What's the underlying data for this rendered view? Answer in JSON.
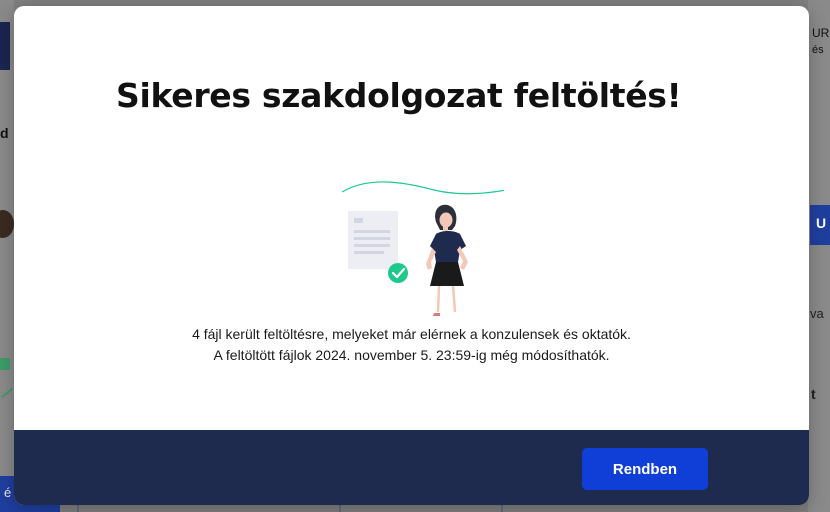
{
  "background": {
    "left_fragment_1": "d",
    "left_button_fragment": "é",
    "right_fragment_1": "UR",
    "right_fragment_2": "és",
    "right_button_fragment": "U",
    "right_fragment_3": "va",
    "right_fragment_4": "t"
  },
  "modal": {
    "title": "Sikeres szakdolgozat feltöltés!",
    "message_line_1": "4 fájl került feltöltésre, melyeket már elérnek a konzulensek és oktatók.",
    "message_line_2": "A feltöltött fájlok 2024. november 5. 23:59-ig még módosíthatók.",
    "ok_button_label": "Rendben"
  },
  "colors": {
    "footer": "#1f2a4f",
    "button": "#0f3fd6",
    "accent_green": "#1ec98b"
  },
  "icons": [
    "document-icon",
    "check-circle-icon",
    "woman-illustration"
  ]
}
